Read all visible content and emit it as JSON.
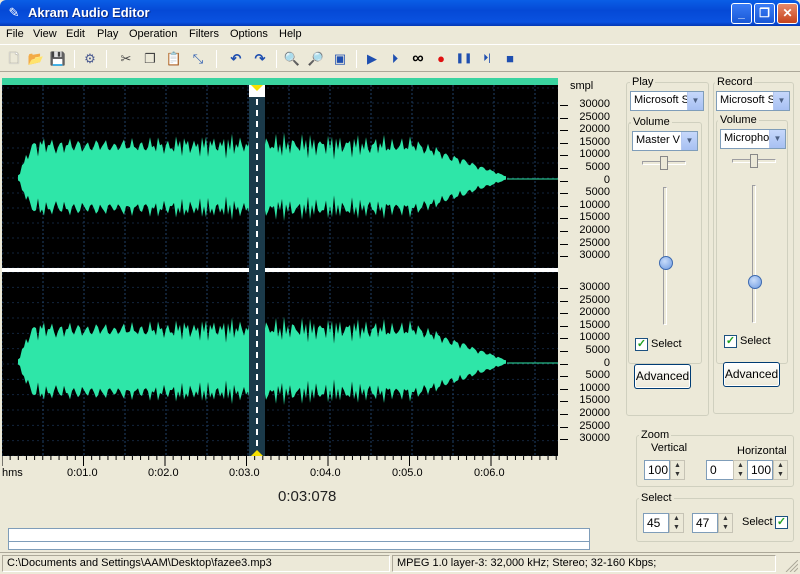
{
  "window": {
    "title": "Akram Audio Editor",
    "icon": "pen-icon"
  },
  "titlebar_buttons": {
    "minimize": "_",
    "maximize": "❐",
    "close": "✕"
  },
  "menu": [
    "File",
    "View",
    "Edit",
    "Play",
    "Operation",
    "Filters",
    "Options",
    "Help"
  ],
  "toolbar": [
    {
      "name": "new-icon",
      "glyph": "🗋"
    },
    {
      "name": "open-icon",
      "glyph": "📂"
    },
    {
      "name": "save-icon",
      "glyph": "💾"
    },
    {
      "name": "settings-icon",
      "glyph": "⚙"
    },
    {
      "name": "cut-icon",
      "glyph": "✂"
    },
    {
      "name": "copy-icon",
      "glyph": "❐"
    },
    {
      "name": "paste-icon",
      "glyph": "📋"
    },
    {
      "name": "trim-icon",
      "glyph": "⤡"
    },
    {
      "name": "undo-icon",
      "glyph": "↶"
    },
    {
      "name": "redo-icon",
      "glyph": "↷"
    },
    {
      "name": "zoom-in-icon",
      "glyph": "🔍"
    },
    {
      "name": "zoom-out-icon",
      "glyph": "🔎"
    },
    {
      "name": "zoom-fit-icon",
      "glyph": "▣"
    },
    {
      "name": "play-icon",
      "glyph": "▶"
    },
    {
      "name": "play-loop-icon",
      "glyph": "⏵"
    },
    {
      "name": "loop-icon",
      "glyph": "∞"
    },
    {
      "name": "record-icon",
      "glyph": "●"
    },
    {
      "name": "pause-icon",
      "glyph": "❚❚"
    },
    {
      "name": "play-selection-icon",
      "glyph": "⏵|"
    },
    {
      "name": "stop-icon",
      "glyph": "■"
    }
  ],
  "ruler": {
    "unit": "smpl",
    "channel1": [
      "30000",
      "25000",
      "20000",
      "15000",
      "10000",
      "5000",
      "0",
      "5000",
      "10000",
      "15000",
      "20000",
      "25000",
      "30000"
    ],
    "channel2": [
      "30000",
      "25000",
      "20000",
      "15000",
      "10000",
      "5000",
      "0",
      "5000",
      "10000",
      "15000",
      "20000",
      "25000",
      "30000"
    ]
  },
  "timeline": {
    "unit": "hms",
    "labels": [
      "0:01.0",
      "0:02.0",
      "0:03.0",
      "0:04.0",
      "0:05.0",
      "0:06.0"
    ]
  },
  "position_readout": "0:03:078",
  "colors": {
    "waveform": "#2ee6a8",
    "selection": "#1b3a4a",
    "background": "#000000",
    "grid": "#1f3f66",
    "overview_bar": "#3ad4a0"
  },
  "play_panel": {
    "label": "Play",
    "device": "Microsoft S",
    "volume_label": "Volume",
    "volume_source": "Master V",
    "select_label": "Select",
    "select_checked": true,
    "advanced_label": "Advanced",
    "volume_level": 0.45
  },
  "record_panel": {
    "label": "Record",
    "device": "Microsoft S",
    "volume_label": "Volume",
    "volume_source": "Micropho",
    "select_label": "Select",
    "select_checked": true,
    "advanced_label": "Advanced",
    "volume_level": 0.3
  },
  "zoom": {
    "label": "Zoom",
    "vertical_label": "Vertical",
    "horizontal_label": "Horizontal",
    "vertical_value": "100",
    "horizontal_from": "0",
    "horizontal_value": "100"
  },
  "select": {
    "label": "Select",
    "from": "45",
    "to": "47",
    "checkbox_label": "Select",
    "checked": true
  },
  "status": {
    "path": "C:\\Documents and Settings\\AAM\\Desktop\\fazee3.mp3",
    "format": "MPEG 1.0 layer-3: 32,000 kHz; Stereo; 32-160 Kbps;"
  }
}
